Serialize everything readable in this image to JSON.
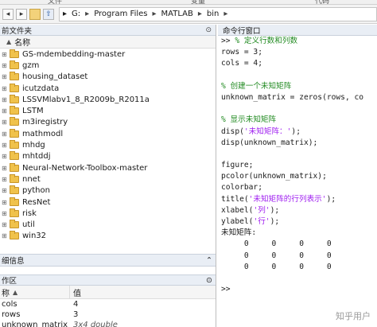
{
  "menu": {
    "item_left": "文件",
    "item_mid": "变量",
    "item_right": "代码"
  },
  "toolbar": {
    "buttons": [
      "back",
      "forward",
      "open-folder",
      "up-folder"
    ],
    "path": [
      "G:",
      "Program Files",
      "MATLAB",
      "bin"
    ]
  },
  "file_browser": {
    "title": "前文件夹",
    "header": "名称",
    "items": [
      "GS-mdembedding-master",
      "gzm",
      "housing_dataset",
      "icutzdata",
      "LSSVMlabv1_8_R2009b_R2011a",
      "LSTM",
      "m3iregistry",
      "mathmodl",
      "mhdg",
      "mhtddj",
      "Neural-Network-Toolbox-master",
      "nnet",
      "python",
      "ResNet",
      "risk",
      "util",
      "win32"
    ]
  },
  "details": {
    "title": "细信息"
  },
  "workspace": {
    "title": "作区",
    "col_name": "称",
    "col_value": "值",
    "rows": [
      {
        "name": "cols",
        "value": "4"
      },
      {
        "name": "rows",
        "value": "3"
      },
      {
        "name": "unknown_matrix",
        "value": "3x4 double"
      }
    ]
  },
  "command_window": {
    "title": "命令行窗口",
    "lines": [
      {
        "t": "code",
        "text": ">> % 定义行数和列数",
        "style": "comment"
      },
      {
        "t": "code",
        "text": "rows = 3;"
      },
      {
        "t": "code",
        "text": "cols = 4;"
      },
      {
        "t": "blank"
      },
      {
        "t": "code",
        "text": "% 创建一个未知矩阵",
        "style": "comment"
      },
      {
        "t": "code",
        "text": "unknown_matrix = zeros(rows, co"
      },
      {
        "t": "blank"
      },
      {
        "t": "code",
        "text": "% 显示未知矩阵",
        "style": "comment"
      },
      {
        "t": "code",
        "text": "disp('未知矩阵：');"
      },
      {
        "t": "code",
        "text": "disp(unknown_matrix);"
      },
      {
        "t": "blank"
      },
      {
        "t": "code",
        "text": "figure;"
      },
      {
        "t": "code",
        "text": "pcolor(unknown_matrix);"
      },
      {
        "t": "code",
        "text": "colorbar;"
      },
      {
        "t": "code",
        "text": "title('未知矩阵的行列表示');"
      },
      {
        "t": "code",
        "text": "xlabel('列');"
      },
      {
        "t": "code",
        "text": "ylabel('行');"
      },
      {
        "t": "code",
        "text": "未知矩阵:"
      },
      {
        "t": "code",
        "text": "     0     0     0     0"
      },
      {
        "t": "code",
        "text": "     0     0     0     0"
      },
      {
        "t": "code",
        "text": "     0     0     0     0"
      },
      {
        "t": "blank"
      },
      {
        "t": "code",
        "text": ">>"
      }
    ]
  },
  "watermark": "知乎用户"
}
